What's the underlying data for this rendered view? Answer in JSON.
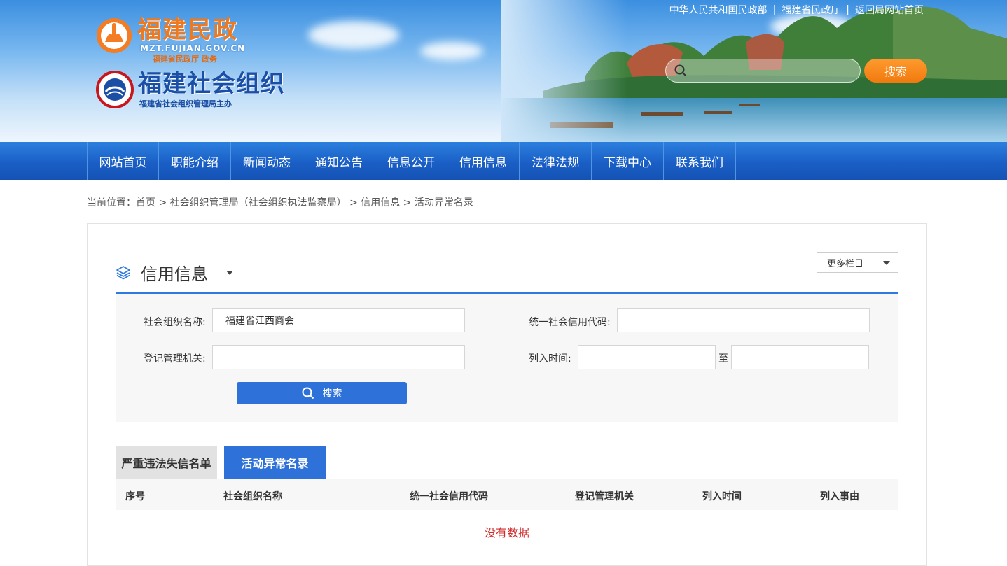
{
  "top_links": [
    "中华人民共和国民政部",
    "福建省民政厅",
    "返回局网站首页"
  ],
  "top_links_sep": "|",
  "logo1": {
    "title": "福建民政",
    "url": "MZT.FUJIAN.GOV.CN",
    "sub": "福建省民政厅 政务"
  },
  "logo2": {
    "title": "福建社会组织",
    "sub": "福建省社会组织管理局主办"
  },
  "header_search": {
    "placeholder": "",
    "button": "搜索"
  },
  "nav": [
    "网站首页",
    "职能介绍",
    "新闻动态",
    "通知公告",
    "信息公开",
    "信用信息",
    "法律法规",
    "下载中心",
    "联系我们"
  ],
  "breadcrumb": {
    "prefix": "当前位置：",
    "items": [
      "首页",
      "社会组织管理局（社会组织执法监察局）",
      "信用信息",
      "活动异常名录"
    ],
    "sep": ">"
  },
  "section": {
    "title": "信用信息",
    "more": "更多栏目"
  },
  "form": {
    "org_name_label": "社会组织名称:",
    "org_name_value": "福建省江西商会",
    "credit_code_label": "统一社会信用代码:",
    "credit_code_value": "",
    "reg_org_label": "登记管理机关:",
    "reg_org_value": "",
    "list_time_label": "列入时间:",
    "time_from": "",
    "time_to_label": "至",
    "time_to": "",
    "submit": "搜索"
  },
  "tabs": [
    {
      "label": "严重违法失信名单",
      "active": false
    },
    {
      "label": "活动异常名录",
      "active": true
    }
  ],
  "table": {
    "columns": [
      "序号",
      "社会组织名称",
      "统一社会信用代码",
      "登记管理机关",
      "列入时间",
      "列入事由"
    ],
    "empty": "没有数据"
  },
  "colors": {
    "nav_blue": "#1a5fc6",
    "accent_blue": "#2e72d9",
    "orange": "#f07a0e",
    "empty_red": "#d02c2c"
  }
}
